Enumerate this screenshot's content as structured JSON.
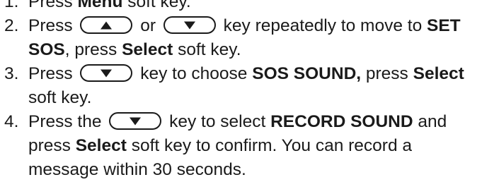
{
  "steps": [
    {
      "num": "1.",
      "t1": "Press ",
      "b1": "Menu",
      "t2": " soft key."
    },
    {
      "num": "2.",
      "t1": "Press ",
      "key1": "up-arrow-key-icon",
      "t2": " or ",
      "key2": "down-arrow-key-icon",
      "t3": " key repeatedly to move to ",
      "b1": "SET SOS",
      "t4": ", press ",
      "b2": "Select",
      "t5": " soft key."
    },
    {
      "num": "3.",
      "t1": "Press ",
      "key1": "down-arrow-key-icon",
      "t2": " key to choose ",
      "b1": "SOS SOUND,",
      "t3": " press ",
      "b2": "Select",
      "t4": " soft key."
    },
    {
      "num": "4.",
      "t1": "Press the ",
      "key1": "down-arrow-key-icon",
      "t2": " key to select ",
      "b1": "RECORD SOUND",
      "t3": " and press ",
      "b2": "Select",
      "t4": " soft key to confirm. You can record a message within 30 seconds."
    }
  ]
}
